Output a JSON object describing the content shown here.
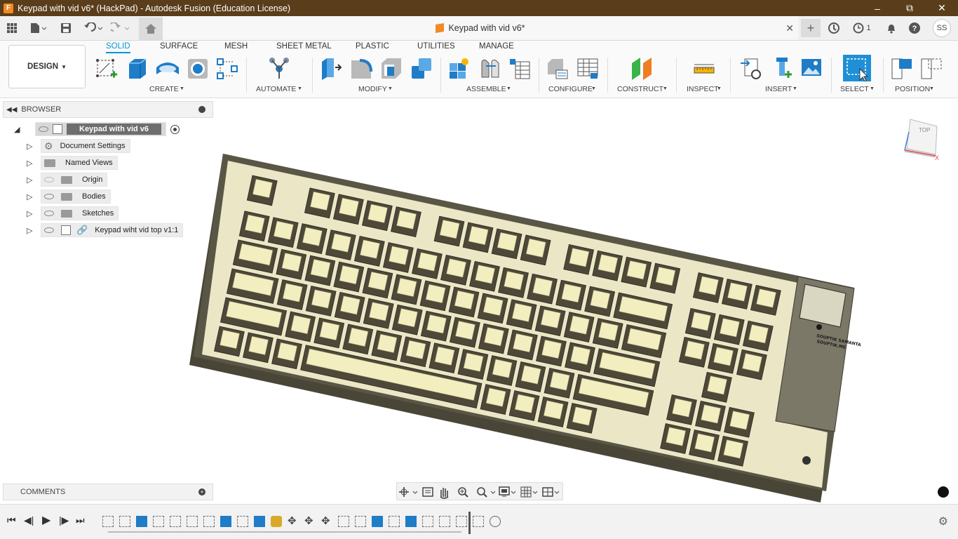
{
  "window": {
    "title": "Keypad with vid v6* (HackPad) - Autodesk Fusion (Education License)",
    "app_icon_letter": "F"
  },
  "document_tab": {
    "name": "Keypad with vid v6*"
  },
  "quick_access": {
    "job_count": "1",
    "user_initials": "SS"
  },
  "workspace": {
    "label": "DESIGN"
  },
  "ribbon": {
    "tabs": [
      {
        "label": "SOLID",
        "active": true
      },
      {
        "label": "SURFACE"
      },
      {
        "label": "MESH"
      },
      {
        "label": "SHEET METAL"
      },
      {
        "label": "PLASTIC"
      },
      {
        "label": "UTILITIES"
      },
      {
        "label": "MANAGE"
      }
    ],
    "groups": [
      "CREATE",
      "AUTOMATE",
      "MODIFY",
      "ASSEMBLE",
      "CONFIGURE",
      "CONSTRUCT",
      "INSPECT",
      "INSERT",
      "SELECT",
      "POSITION"
    ]
  },
  "browser": {
    "title": "BROWSER",
    "root": "Keypad with vid v6",
    "items": [
      {
        "label": "Document Settings",
        "icon": "gear-icon"
      },
      {
        "label": "Named Views",
        "icon": "folder-icon"
      },
      {
        "label": "Origin",
        "icon": "folder-icon"
      },
      {
        "label": "Bodies",
        "icon": "folder-icon"
      },
      {
        "label": "Sketches",
        "icon": "folder-icon"
      },
      {
        "label": "Keypad wiht vid top v1:1",
        "icon": "component-icon"
      }
    ]
  },
  "comments": {
    "title": "COMMENTS"
  },
  "viewcube": {
    "face": "TOP",
    "axis_x": "X"
  },
  "model": {
    "display_text_line1": "SOUPTIK SAMANTA",
    "display_text_line2": "SOUPTIK.ME"
  },
  "colors": {
    "titlebar": "#5a3d1a",
    "accent": "#0696d7",
    "model_fill": "#e9e6c4",
    "model_dark": "#4a4637"
  }
}
